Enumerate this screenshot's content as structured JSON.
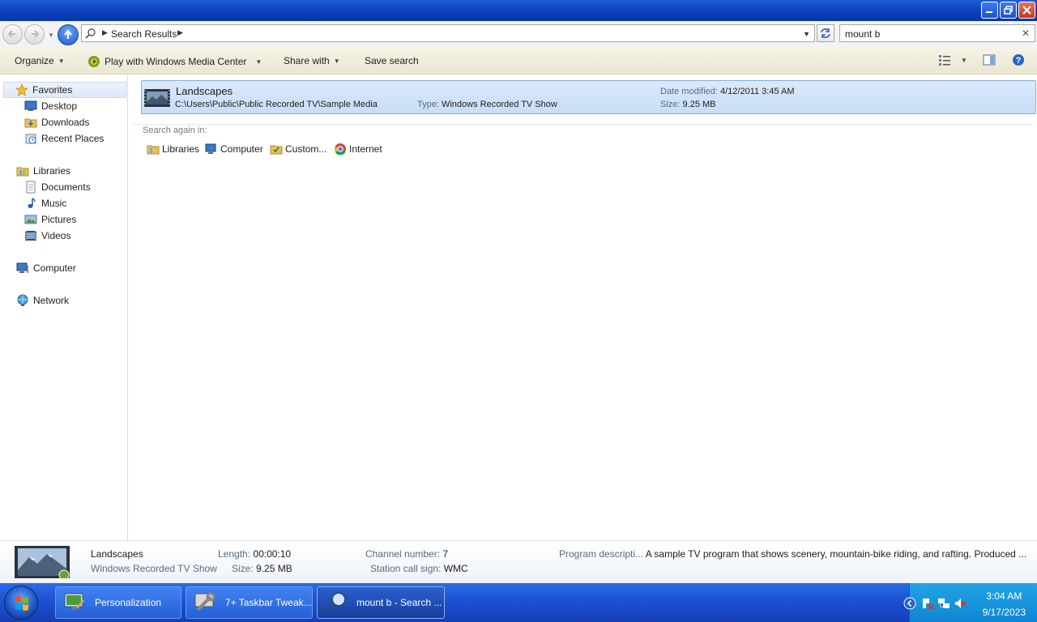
{
  "address": {
    "location": "Search Results"
  },
  "search": {
    "query": "mount b"
  },
  "toolbar": {
    "organize": "Organize",
    "play_wmc": "Play with Windows Media Center",
    "share_with": "Share with",
    "save_search": "Save search"
  },
  "sidebar": {
    "favorites": "Favorites",
    "favorites_items": [
      "Desktop",
      "Downloads",
      "Recent Places"
    ],
    "libraries": "Libraries",
    "libraries_items": [
      "Documents",
      "Music",
      "Pictures",
      "Videos"
    ],
    "computer": "Computer",
    "network": "Network"
  },
  "result": {
    "title": "Landscapes",
    "path": "C:\\Users\\Public\\Public Recorded TV\\Sample Media",
    "type_label": "Type:",
    "type_value": "Windows Recorded TV Show",
    "date_label": "Date modified:",
    "date_value": "4/12/2011 3:45 AM",
    "size_label": "Size:",
    "size_value": "9.25 MB"
  },
  "search_again": {
    "title": "Search again in:",
    "items": [
      "Libraries",
      "Computer",
      "Custom...",
      "Internet"
    ]
  },
  "details": {
    "name": "Landscapes",
    "type": "Windows Recorded TV Show",
    "length_label": "Length:",
    "length_value": "00:00:10",
    "size_label": "Size:",
    "size_value": "9.25 MB",
    "channel_label": "Channel number:",
    "channel_value": "7",
    "station_label": "Station call sign:",
    "station_value": "WMC",
    "program_label": "Program descripti...",
    "program_value": "A sample TV program that shows scenery, mountain-bike riding, and rafting. Produced ..."
  },
  "taskbar": {
    "tasks": [
      "Personalization",
      "7+ Taskbar Tweak...",
      "mount b - Search ..."
    ],
    "time": "3:04 AM",
    "date": "9/17/2023"
  },
  "colors": {
    "title_bar": "#0a3fb9",
    "selection": "#c8ddf7",
    "taskbar": "#1c4fd0",
    "tray": "#0f86d3"
  }
}
